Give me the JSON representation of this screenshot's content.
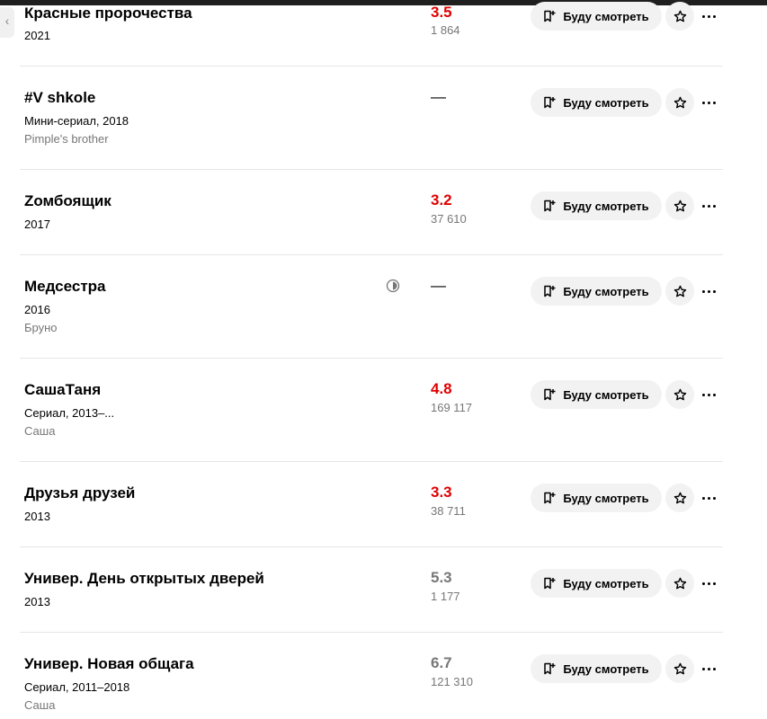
{
  "buttons": {
    "watch_label": "Буду смотреть"
  },
  "icons": {
    "watchlist": "bookmark-add-icon",
    "rate": "star-icon",
    "more": "more-dots-icon",
    "watched": "half-circle-icon"
  },
  "colors": {
    "rating_low": "#e00000",
    "rating_mid": "#777777"
  },
  "films": [
    {
      "title": "Красные пророчества",
      "meta": "2021",
      "sub": "",
      "rating": "3.5",
      "votes": "1 864"
    },
    {
      "title": "#V shkole",
      "meta": "Мини-сериал, 2018",
      "sub": "Pimple's brother",
      "rating": "—",
      "votes": ""
    },
    {
      "title": "Zомбоящик",
      "meta": "2017",
      "sub": "",
      "rating": "3.2",
      "votes": "37 610"
    },
    {
      "title": "Медсестра",
      "meta": "2016",
      "sub": "Бруно",
      "rating": "—",
      "votes": ""
    },
    {
      "title": "СашаТаня",
      "meta": "Сериал, 2013–...",
      "sub": "Саша",
      "rating": "4.8",
      "votes": "169 117"
    },
    {
      "title": "Друзья друзей",
      "meta": "2013",
      "sub": "",
      "rating": "3.3",
      "votes": "38 711"
    },
    {
      "title": "Универ. День открытых дверей",
      "meta": "2013",
      "sub": "",
      "rating": "5.3",
      "votes": "1 177"
    },
    {
      "title": "Универ. Новая общага",
      "meta": "Сериал, 2011–2018",
      "sub": "Саша",
      "rating": "6.7",
      "votes": "121 310"
    }
  ]
}
